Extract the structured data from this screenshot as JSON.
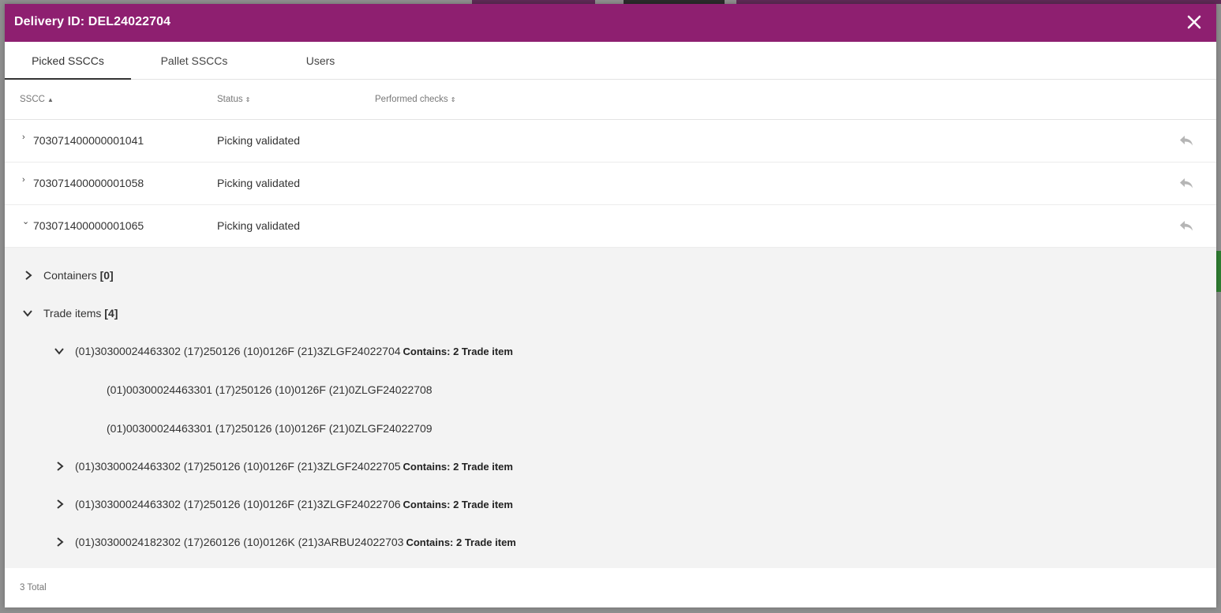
{
  "modal": {
    "title": "Delivery ID: DEL24022704",
    "close_icon": "close-icon",
    "header_color": "#8e1f70"
  },
  "tabs": [
    {
      "label": "Picked SSCCs",
      "active": true
    },
    {
      "label": "Pallet SSCCs",
      "active": false
    },
    {
      "label": "Users",
      "active": false
    }
  ],
  "table": {
    "headers": {
      "sscc": "SSCC",
      "status": "Status",
      "checks": "Performed checks"
    },
    "rows": [
      {
        "sscc": "703071400000001041",
        "status": "Picking validated",
        "expanded": false
      },
      {
        "sscc": "703071400000001058",
        "status": "Picking validated",
        "expanded": false
      },
      {
        "sscc": "703071400000001065",
        "status": "Picking validated",
        "expanded": true
      }
    ]
  },
  "detail": {
    "containers": {
      "label": "Containers",
      "count": "[0]"
    },
    "trade_items": {
      "label": "Trade items",
      "count": "[4]"
    },
    "items": [
      {
        "code": "(01)30300024463302 (17)250126 (10)0126F (21)3ZLGF24022704",
        "contains": "Contains: 2 Trade item",
        "expanded": true
      },
      {
        "code": "(01)30300024463302 (17)250126 (10)0126F (21)3ZLGF24022705",
        "contains": "Contains: 2 Trade item",
        "expanded": false
      },
      {
        "code": "(01)30300024463302 (17)250126 (10)0126F (21)3ZLGF24022706",
        "contains": "Contains: 2 Trade item",
        "expanded": false
      },
      {
        "code": "(01)30300024182302 (17)260126 (10)0126K (21)3ARBU24022703",
        "contains": "Contains: 2 Trade item",
        "expanded": false
      }
    ],
    "sub_items": [
      "(01)00300024463301 (17)250126 (10)0126F (21)0ZLGF24022708",
      "(01)00300024463301 (17)250126 (10)0126F (21)0ZLGF24022709"
    ]
  },
  "footer": {
    "total": "3 Total"
  }
}
